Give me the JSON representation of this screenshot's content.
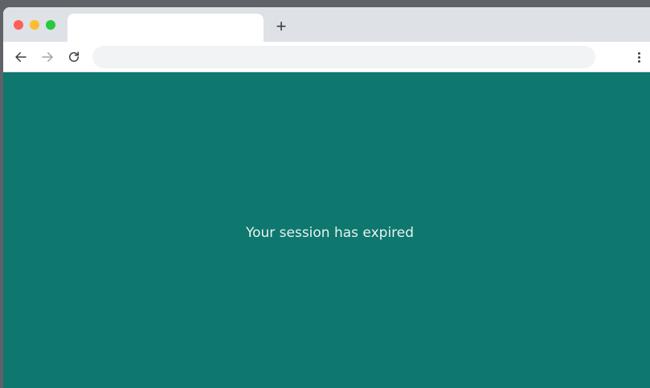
{
  "browser": {
    "tab": {
      "title": ""
    },
    "new_tab_label": "+",
    "address_bar": {
      "value": "",
      "placeholder": ""
    },
    "icons": {
      "back": "arrow-left-icon",
      "forward": "arrow-right-icon",
      "reload": "reload-icon",
      "menu": "more-vertical-icon",
      "new_tab": "plus-icon"
    },
    "window_controls": {
      "close_color": "#ff5f57",
      "minimize_color": "#febc2e",
      "zoom_color": "#28c840"
    }
  },
  "page": {
    "background_color": "#0e776e",
    "message": "Your session has expired"
  }
}
